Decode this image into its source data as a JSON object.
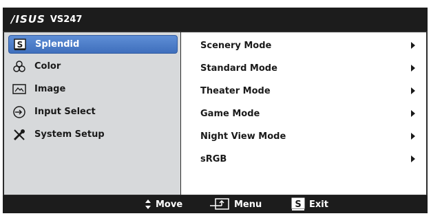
{
  "title": {
    "brand": "/ISUS",
    "model": "VS247"
  },
  "main_menu": [
    {
      "label": "Splendid",
      "icon": "splendid-s-icon",
      "selected": true
    },
    {
      "label": "Color",
      "icon": "color-dots-icon",
      "selected": false
    },
    {
      "label": "Image",
      "icon": "image-icon",
      "selected": false
    },
    {
      "label": "Input Select",
      "icon": "input-arrow-icon",
      "selected": false
    },
    {
      "label": "System Setup",
      "icon": "wrench-icon",
      "selected": false
    }
  ],
  "sub_menu": [
    {
      "label": "Scenery Mode"
    },
    {
      "label": "Standard Mode"
    },
    {
      "label": "Theater Mode"
    },
    {
      "label": "Game Mode"
    },
    {
      "label": "Night View Mode"
    },
    {
      "label": "sRGB"
    }
  ],
  "footer": {
    "move_label": "Move",
    "menu_label": "Menu",
    "exit_label": "Exit"
  },
  "colors": {
    "selected": "#4a7cc9",
    "osd_dark": "#1c1c1c",
    "left_pane": "#d7d9db"
  }
}
